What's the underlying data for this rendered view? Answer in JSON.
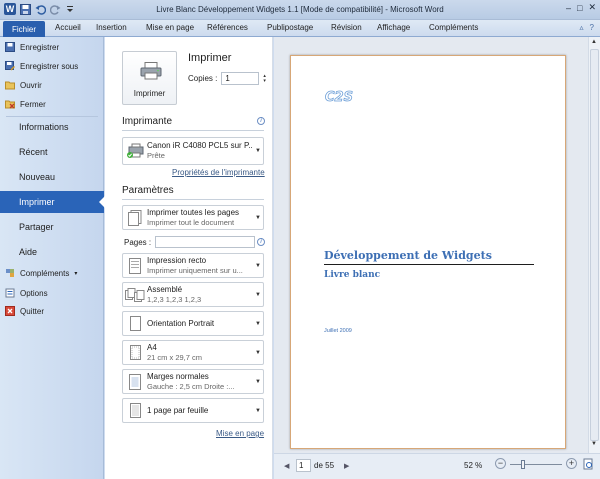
{
  "window": {
    "title": "Livre Blanc Développement Widgets 1.1 [Mode de compatibilité]  -  Microsoft Word",
    "app_icon": "W",
    "minimize": "–",
    "maximize": "□",
    "close": "✕"
  },
  "ribbon": {
    "file_tab": "Fichier",
    "tabs": [
      "Accueil",
      "Insertion",
      "Mise en page",
      "Références",
      "Publipostage",
      "Révision",
      "Affichage",
      "Compléments"
    ]
  },
  "sidebar": {
    "small_top": [
      "Enregistrer",
      "Enregistrer sous",
      "Ouvrir",
      "Fermer"
    ],
    "large": [
      "Informations",
      "Récent",
      "Nouveau",
      "Imprimer",
      "Partager",
      "Aide"
    ],
    "small_bottom": [
      "Compléments",
      "Options",
      "Quitter"
    ],
    "selected": "Imprimer"
  },
  "print": {
    "heading": "Imprimer",
    "button_label": "Imprimer",
    "copies_label": "Copies :",
    "copies_value": "1",
    "printer_heading": "Imprimante",
    "printer_name": "Canon iR C4080 PCL5 sur P...",
    "printer_status": "Prête",
    "printer_props_link": "Propriétés de l'imprimante",
    "params_heading": "Paramètres",
    "pages_label": "Pages :",
    "pages_value": "",
    "page_setup_link": "Mise en page",
    "settings": [
      {
        "line1": "Imprimer toutes les pages",
        "line2": "Imprimer tout le document",
        "icon": "pages-icon"
      },
      {
        "line1": "Impression recto",
        "line2": "Imprimer uniquement sur u...",
        "icon": "one-sided-icon"
      },
      {
        "line1": "Assemblé",
        "line2": "1,2,3    1,2,3    1,2,3",
        "icon": "collate-icon"
      },
      {
        "line1": "Orientation Portrait",
        "line2": "",
        "icon": "portrait-icon"
      },
      {
        "line1": "A4",
        "line2": "21 cm x 29,7 cm",
        "icon": "paper-size-icon"
      },
      {
        "line1": "Marges normales",
        "line2": "Gauche :  2,5 cm    Droite :...",
        "icon": "margins-icon"
      },
      {
        "line1": "1 page par feuille",
        "line2": "",
        "icon": "pages-per-sheet-icon"
      }
    ]
  },
  "preview": {
    "logo_text": "C2S",
    "doc_title": "Développement de Widgets",
    "doc_subtitle": "Livre blanc",
    "doc_date": "Juillet 2009",
    "page_current": "1",
    "page_total": "de 55",
    "zoom": "52 %",
    "zoom_level": 0.52
  },
  "colors": {
    "accent": "#2a64b8",
    "doc_title": "#3d6fb4"
  }
}
